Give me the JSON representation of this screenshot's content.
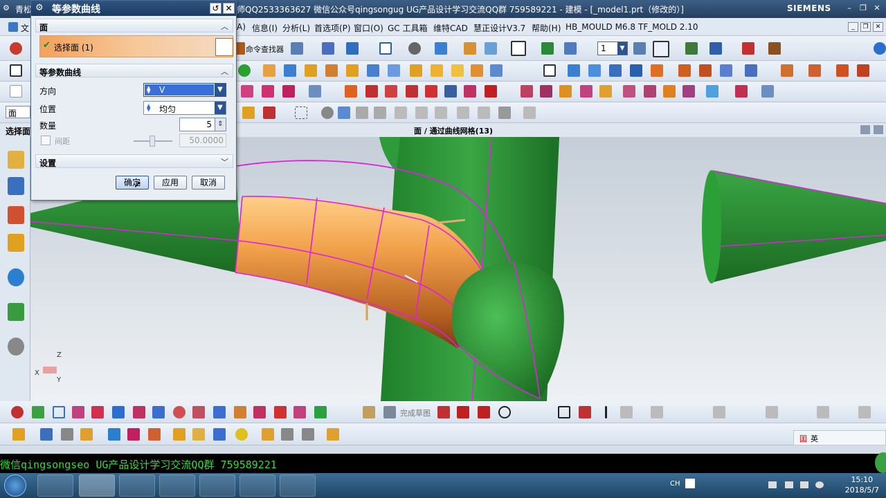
{
  "window": {
    "title": "师QQ2533363627 微信公众号qingsongug UG产品设计学习交流QQ群 759589221 - 建模 - [_model1.prt（修改的）]",
    "brand": "SIEMENS",
    "left_fragment": "青松"
  },
  "menu": [
    "A)",
    "信息(I)",
    "分析(L)",
    "首选项(P)",
    "窗口(O)",
    "GC 工具箱",
    "维特CAD",
    "慧正设计V3.7",
    "帮助(H)",
    "HB_MOULD M6.8",
    "TF_MOLD 2.10"
  ],
  "toolbar": {
    "command_finder": "命令查找器",
    "layer_value": "1",
    "filter_label": "面",
    "select_label": "选择面",
    "sketch_label": "完成草图",
    "file_fragment": "文"
  },
  "viewport": {
    "caption": "面 / 通过曲线网格(13)",
    "triad": {
      "x": "X",
      "y": "Y",
      "z": "Z"
    }
  },
  "dialog": {
    "title": "等参数曲线",
    "section_face": "面",
    "select_face": "选择面 (1)",
    "section_iso": "等参数曲线",
    "direction_label": "方向",
    "direction_value": "V",
    "position_label": "位置",
    "position_value": "均匀",
    "count_label": "数量",
    "count_value": "5",
    "spacing_label": "间距",
    "spacing_value": "50.0000",
    "section_settings": "设置",
    "ok": "确定",
    "apply": "应用",
    "cancel": "取消"
  },
  "console": "微信qingsongseo  UG产品设计学习交流QQ群 759589221",
  "taskbar": {
    "lang": "CH",
    "time": "15:10",
    "date": "2018/5/7"
  },
  "status_ime": "英",
  "colors": {
    "accent": "#2a5590",
    "surface_green": "#2e9a3a",
    "surface_orange": "#e88a2a",
    "edge_magenta": "#e020e0"
  }
}
